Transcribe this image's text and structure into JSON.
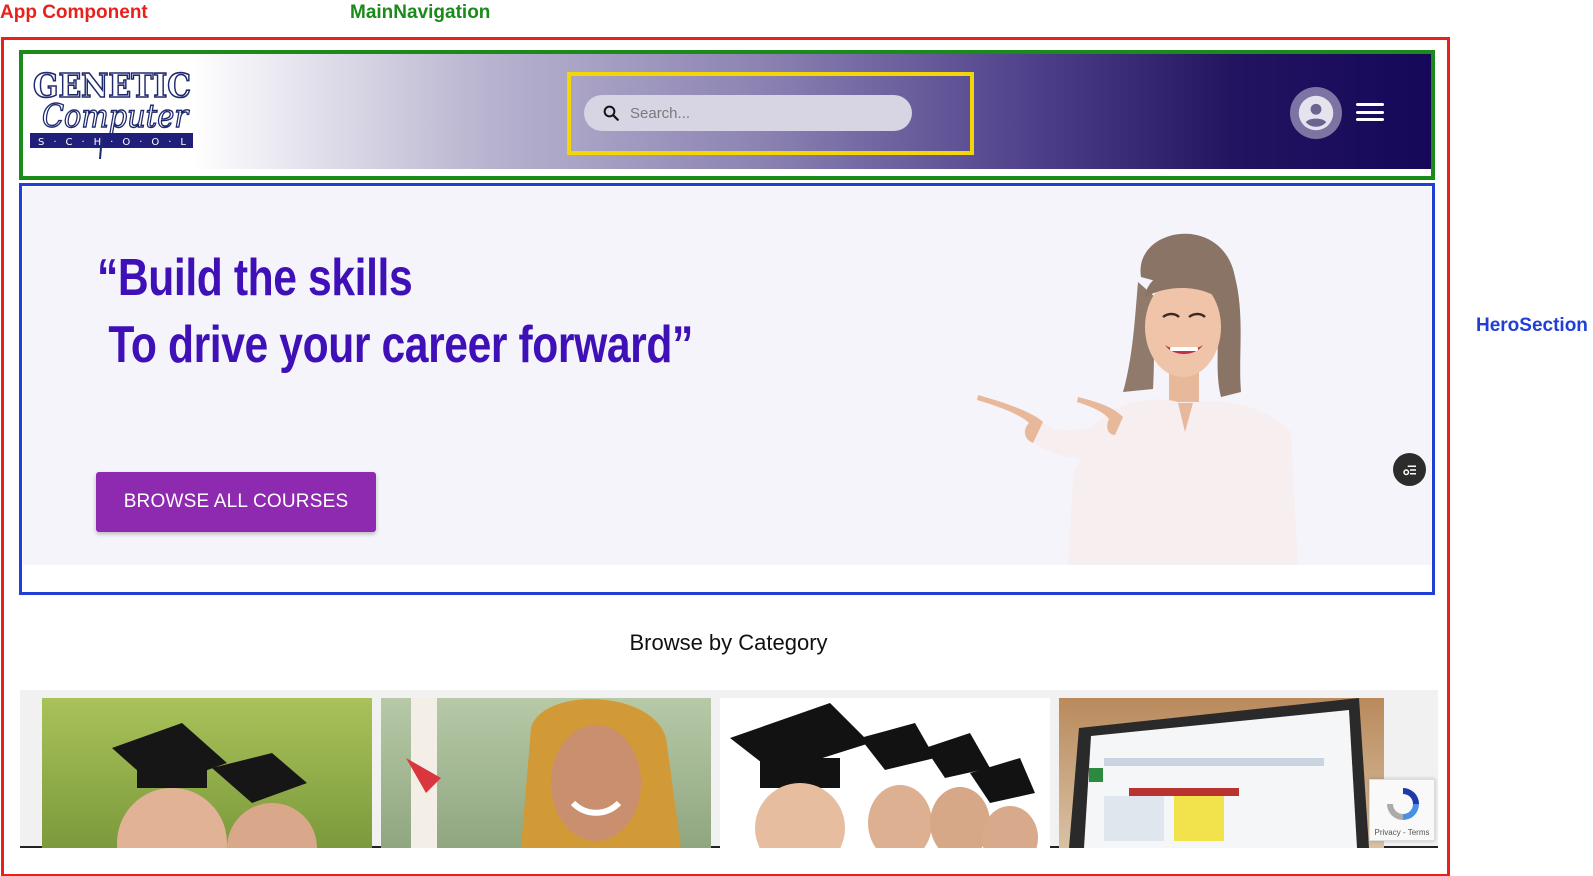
{
  "annotations": {
    "app_label": "App Component",
    "nav_label": "MainNavigation",
    "hero_label": "HeroSection",
    "colors": {
      "app": "#e8211d",
      "nav": "#1a8a1a",
      "hero": "#1f3fd6",
      "search": "#f2d60a"
    }
  },
  "nav": {
    "logo": {
      "line1": "GENETIC",
      "line2": "Computer",
      "line3": "S C H O O L"
    },
    "search": {
      "placeholder": "Search...",
      "icon": "search-icon"
    },
    "avatar_icon": "account-circle-icon",
    "menu_icon": "hamburger-menu-icon"
  },
  "hero": {
    "headline_line1": "“Build the skills",
    "headline_line2": " To drive your career forward”",
    "cta_label": "BROWSE ALL COURSES",
    "accent_color": "#3f10b8",
    "cta_color": "#8e2ab0"
  },
  "category": {
    "title": "Browse by Category",
    "cards": [
      "graduates-photo",
      "graduate-hijab-photo",
      "graduates-row-photo",
      "laptop-spreadsheet-photo"
    ]
  },
  "recaptcha": {
    "text": "Privacy - Terms"
  }
}
